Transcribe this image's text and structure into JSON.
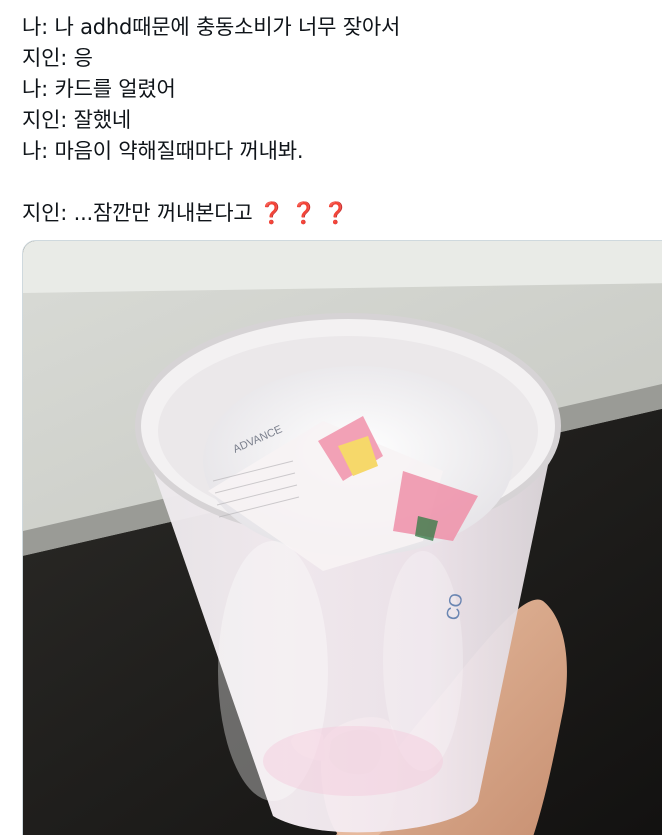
{
  "tweet": {
    "lines": [
      "나: 나 adhd때문에 충동소비가 너무 잦아서",
      "지인: 응",
      "나: 카드를 얼렸어",
      "지인: 잘했네",
      "나: 마음이 약해질때마다 꺼내봐."
    ],
    "last_line": "지인: ...잠깐만 꺼내본다고",
    "emoji": "❓❓❓"
  },
  "photo": {
    "card_text": "ADVANCE"
  }
}
